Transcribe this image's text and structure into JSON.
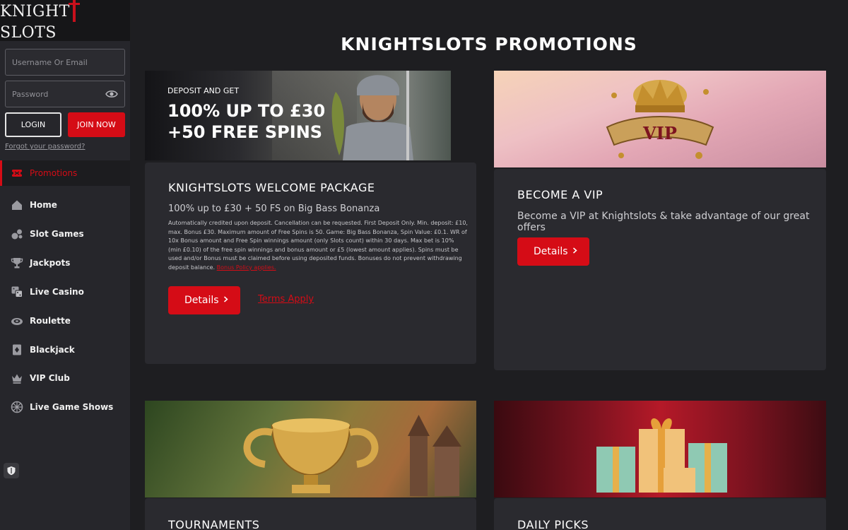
{
  "brand": {
    "logo_left": "KNIGHT",
    "logo_right": "SLOTS"
  },
  "login": {
    "username_placeholder": "Username Or Email",
    "password_placeholder": "Password",
    "login_label": "LOGIN",
    "join_label": "JOIN NOW",
    "forgot_label": "Forgot your password?"
  },
  "sidebar": {
    "items": [
      {
        "label": "Promotions",
        "icon": "ticket-icon",
        "active": true
      },
      {
        "label": "Home",
        "icon": "home-icon"
      },
      {
        "label": "Slot Games",
        "icon": "slot-games-icon"
      },
      {
        "label": "Jackpots",
        "icon": "trophy-icon"
      },
      {
        "label": "Live Casino",
        "icon": "dice-icon"
      },
      {
        "label": "Roulette",
        "icon": "roulette-icon"
      },
      {
        "label": "Blackjack",
        "icon": "cards-icon"
      },
      {
        "label": "VIP Club",
        "icon": "crown-icon"
      },
      {
        "label": "Live Game Shows",
        "icon": "wheel-icon"
      }
    ]
  },
  "page": {
    "title": "KNIGHTSLOTS PROMOTIONS"
  },
  "promos": [
    {
      "banner_small": "DEPOSIT AND GET",
      "banner_line1": "100% UP TO £30",
      "banner_line2": "+50 FREE SPINS",
      "title": "KNIGHTSLOTS WELCOME PACKAGE",
      "subtitle": "100% up to £30 + 50 FS on Big Bass Bonanza",
      "terms_text": "Automatically credited upon deposit. Cancellation can be requested. First Deposit Only. Min. deposit: £10, max. Bonus £30. Maximum amount of Free Spins is 50. Game: Big Bass Bonanza, Spin Value: £0.1. WR of 10x Bonus amount and Free Spin winnings amount (only Slots count) within 30 days. Max bet is 10% (min £0.10) of the free spin winnings and bonus amount or £5 (lowest amount applies). Spins must be used and/or Bonus must be claimed before using deposited funds. Bonuses do not prevent withdrawing deposit balance.",
      "terms_link": "Bonus Policy applies.",
      "details_label": "Details",
      "terms_apply_label": "Terms Apply"
    },
    {
      "title": "BECOME A VIP",
      "subtitle": "Become a VIP at Knightslots & take advantage of our great offers",
      "details_label": "Details",
      "banner_text": "VIP"
    },
    {
      "title": "TOURNAMENTS"
    },
    {
      "title": "DAILY PICKS"
    }
  ],
  "colors": {
    "accent": "#d50c16",
    "bg": "#1e1e21",
    "card": "#2a2a2f",
    "sidebar": "#26262b"
  }
}
